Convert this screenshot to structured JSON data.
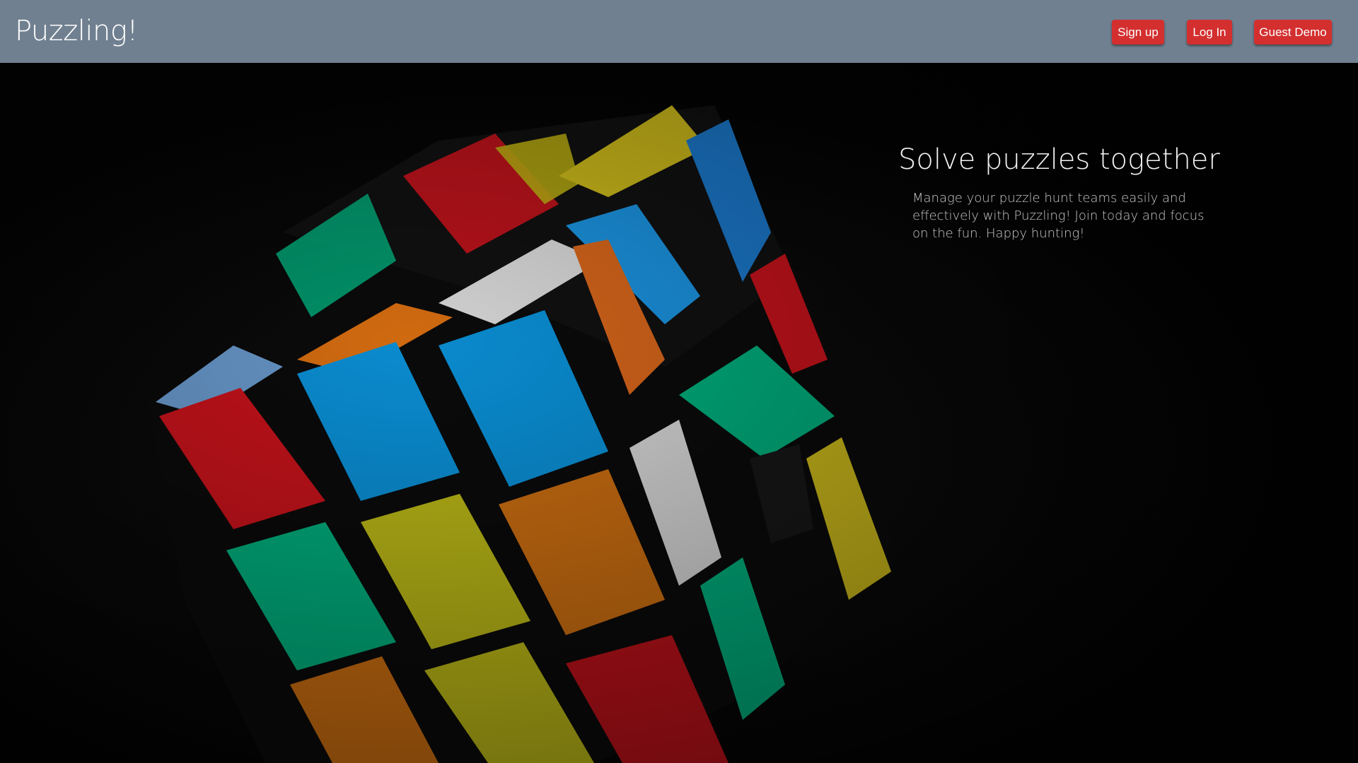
{
  "header": {
    "brand": "Puzzling!",
    "buttons": {
      "signup": "Sign up",
      "login": "Log In",
      "demo": "Guest Demo"
    }
  },
  "hero": {
    "title": "Solve puzzles together",
    "description": "Manage your puzzle hunt teams easily and effectively with Puzzling! Join today and focus on the fun. Happy hunting!"
  },
  "colors": {
    "navbar": "#708090",
    "button": "#d32f2f",
    "hero_background": "#020202",
    "cube_red": "#c0121a",
    "cube_blue": "#0a8bcf",
    "cube_green": "#00a878",
    "cube_yellow": "#b5b216",
    "cube_orange": "#c46a10",
    "cube_white": "#cfcfcf"
  },
  "icons": {
    "hero_image": "rubiks-cube-image"
  }
}
